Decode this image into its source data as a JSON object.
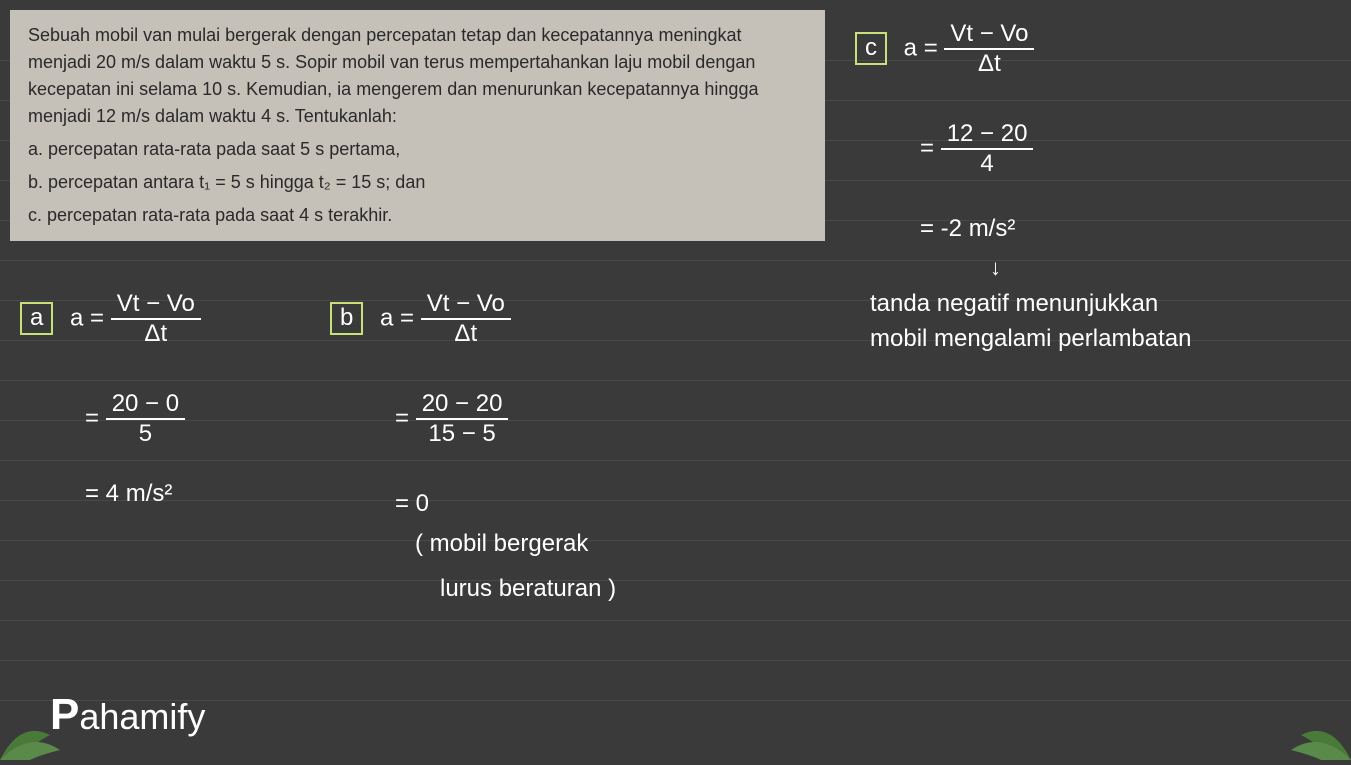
{
  "problem": {
    "intro": "Sebuah mobil van mulai bergerak dengan percepatan tetap dan kecepatannya meningkat menjadi 20 m/s dalam waktu 5 s. Sopir mobil van terus mempertahankan laju mobil dengan kecepatan ini selama 10 s. Kemudian, ia mengerem dan menurunkan kecepatannya hingga menjadi 12 m/s dalam waktu 4 s. Tentukanlah:",
    "qa": "a. percepatan rata-rata pada saat 5 s pertama,",
    "qb": "b. percepatan antara t₁ = 5 s hingga t₂ = 15 s; dan",
    "qc": "c. percepatan rata-rata pada saat 4 s terakhir."
  },
  "labels": {
    "a": "a",
    "b": "b",
    "c": "c"
  },
  "formula": {
    "lhs": "a =",
    "num": "Vt − Vo",
    "den": "Δt"
  },
  "solution_a": {
    "step2_num": "20 − 0",
    "step2_den": "5",
    "result": "= 4 m/s²"
  },
  "solution_b": {
    "step2_num": "20 − 20",
    "step2_den": "15 − 5",
    "result": "= 0",
    "note1": "( mobil bergerak",
    "note2": "lurus beraturan )"
  },
  "solution_c": {
    "step2_num": "12 − 20",
    "step2_den": "4",
    "result": "= -2 m/s²",
    "arrow": "↓",
    "note1": "tanda negatif menunjukkan",
    "note2": "mobil mengalami perlambatan"
  },
  "eq": "=",
  "logo": "Pahamify"
}
